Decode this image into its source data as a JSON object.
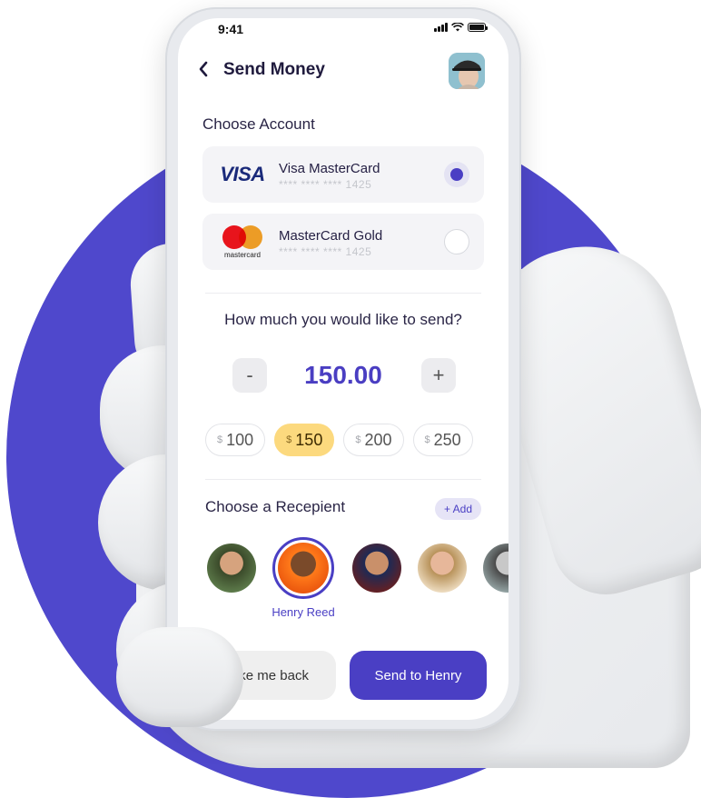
{
  "status_bar": {
    "time": "9:41"
  },
  "header": {
    "title": "Send Money"
  },
  "account": {
    "label": "Choose Account",
    "cards": [
      {
        "logo": "VISA",
        "name": "Visa MasterCard",
        "number": "**** **** **** 1425",
        "selected": true
      },
      {
        "logo": "mastercard",
        "name": "MasterCard Gold",
        "number": "**** **** **** 1425",
        "selected": false
      }
    ]
  },
  "amount": {
    "prompt": "How much you would like to send?",
    "value": "150.00",
    "minus": "-",
    "plus": "+",
    "presets": [
      {
        "currency": "$",
        "value": "100",
        "active": false
      },
      {
        "currency": "$",
        "value": "150",
        "active": true
      },
      {
        "currency": "$",
        "value": "200",
        "active": false
      },
      {
        "currency": "$",
        "value": "250",
        "active": false
      }
    ]
  },
  "recipient": {
    "label": "Choose a Recepient",
    "add_label": "+ Add",
    "selected_name": "Henry Reed"
  },
  "actions": {
    "secondary": "ke me back",
    "primary": "Send to Henry"
  },
  "colors": {
    "accent": "#4a3fc4",
    "background_circle": "#4f48cc",
    "chip_active": "#fcd97e"
  }
}
